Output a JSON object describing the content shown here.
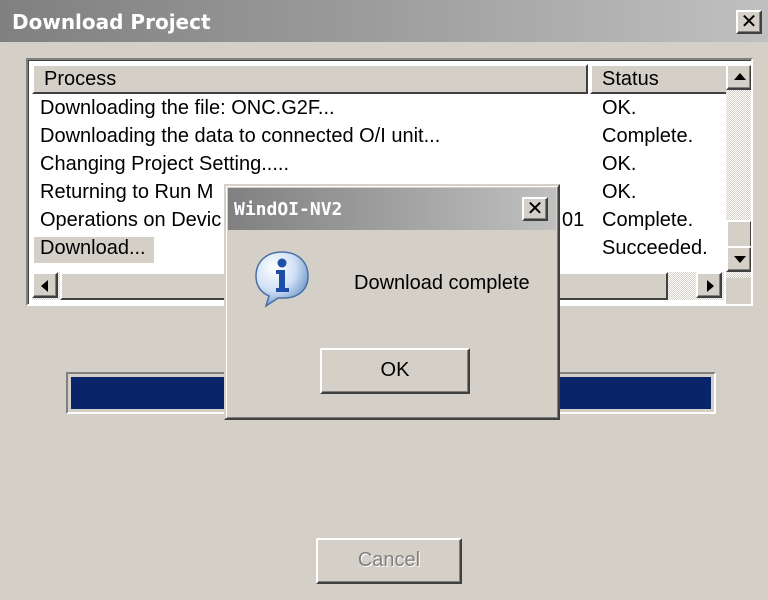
{
  "window": {
    "title": "Download Project",
    "close_glyph": "✕"
  },
  "list": {
    "columns": {
      "process": "Process",
      "status": "Status"
    },
    "rows": [
      {
        "process": "Downloading the file: ONC.G2F...",
        "status": "OK."
      },
      {
        "process": "Downloading the data to connected O/I unit...",
        "status": "Complete."
      },
      {
        "process": "Changing Project Setting.....",
        "status": "OK."
      },
      {
        "process": "Returning to Run M",
        "status": "OK."
      },
      {
        "process": "Operations on Devic",
        "process_tail": "01",
        "status": "Complete."
      },
      {
        "process": "Download...",
        "status": "Succeeded."
      }
    ]
  },
  "progress": {
    "value_percent": 100,
    "color": "#0a246a"
  },
  "buttons": {
    "cancel": "Cancel"
  },
  "message_box": {
    "title": "WindOI-NV2",
    "close_glyph": "✕",
    "icon": "info-icon",
    "text": "Download complete",
    "ok": "OK"
  }
}
